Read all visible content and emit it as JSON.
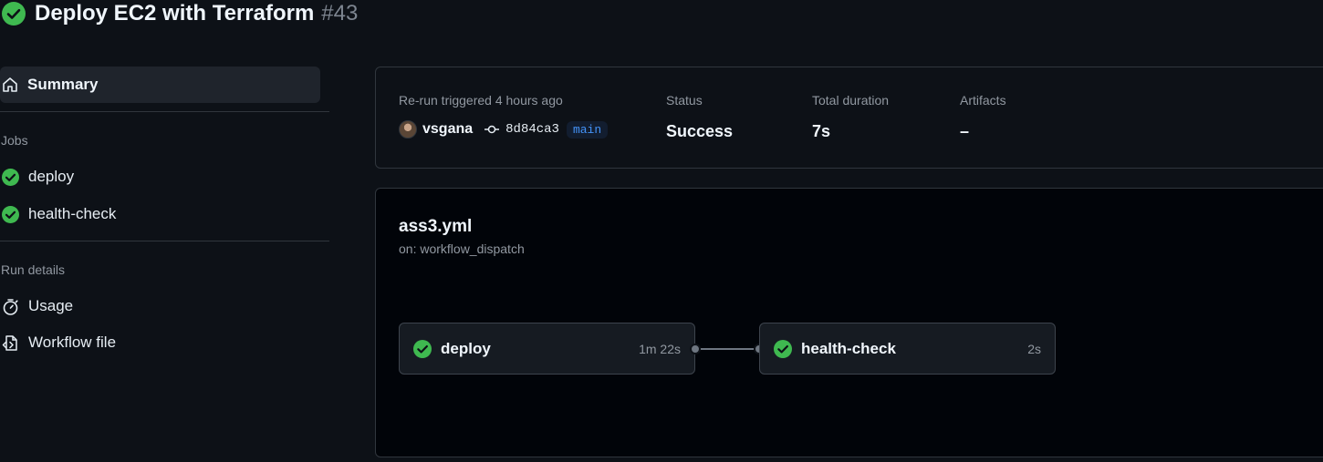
{
  "header": {
    "title": "Deploy EC2 with Terraform",
    "run_number": "#43",
    "status_icon": "check-circle-fill-icon"
  },
  "sidebar": {
    "summary_label": "Summary",
    "jobs_section_label": "Jobs",
    "jobs": [
      {
        "label": "deploy",
        "icon": "check-circle-fill-icon"
      },
      {
        "label": "health-check",
        "icon": "check-circle-fill-icon"
      }
    ],
    "run_details_label": "Run details",
    "details": [
      {
        "label": "Usage",
        "icon": "stopwatch-icon"
      },
      {
        "label": "Workflow file",
        "icon": "file-code-icon"
      }
    ]
  },
  "run_info": {
    "trigger_label": "Re-run triggered 4 hours ago",
    "user": "vsgana",
    "commit_sha": "8d84ca3",
    "branch": "main",
    "status_label": "Status",
    "status_value": "Success",
    "duration_label": "Total duration",
    "duration_value": "7s",
    "artifacts_label": "Artifacts",
    "artifacts_value": "–"
  },
  "workflow": {
    "file": "ass3.yml",
    "trigger": "on: workflow_dispatch",
    "jobs": [
      {
        "name": "deploy",
        "duration": "1m 22s"
      },
      {
        "name": "health-check",
        "duration": "2s"
      }
    ]
  },
  "colors": {
    "success": "#3fb950",
    "background": "#0d1117",
    "branch_text": "#4493f8"
  }
}
